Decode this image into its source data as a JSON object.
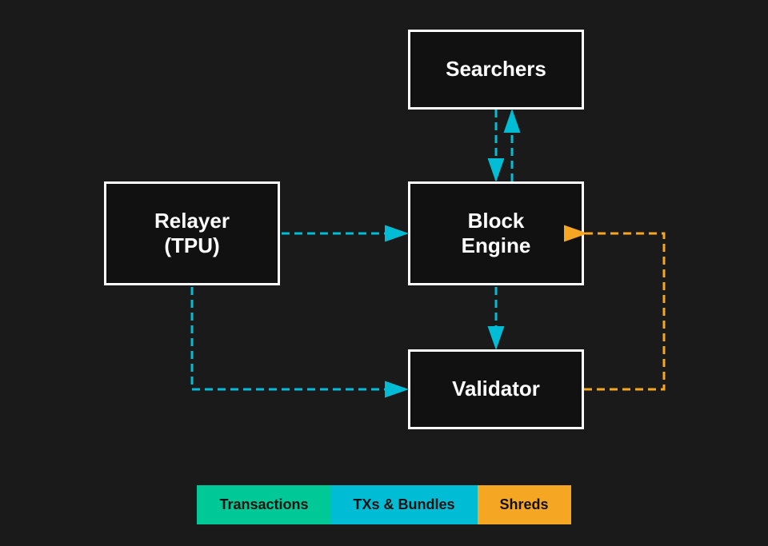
{
  "nodes": {
    "searchers": {
      "label": "Searchers"
    },
    "block_engine": {
      "label": "Block\nEngine"
    },
    "relayer": {
      "label": "Relayer\n(TPU)"
    },
    "validator": {
      "label": "Validator"
    }
  },
  "legend": {
    "transactions": "Transactions",
    "bundles": "TXs & Bundles",
    "shreds": "Shreds"
  },
  "colors": {
    "teal_dark": "#00c896",
    "teal_light": "#00bcd4",
    "orange": "#f5a623",
    "white": "#ffffff",
    "background": "#1a1a1a"
  }
}
